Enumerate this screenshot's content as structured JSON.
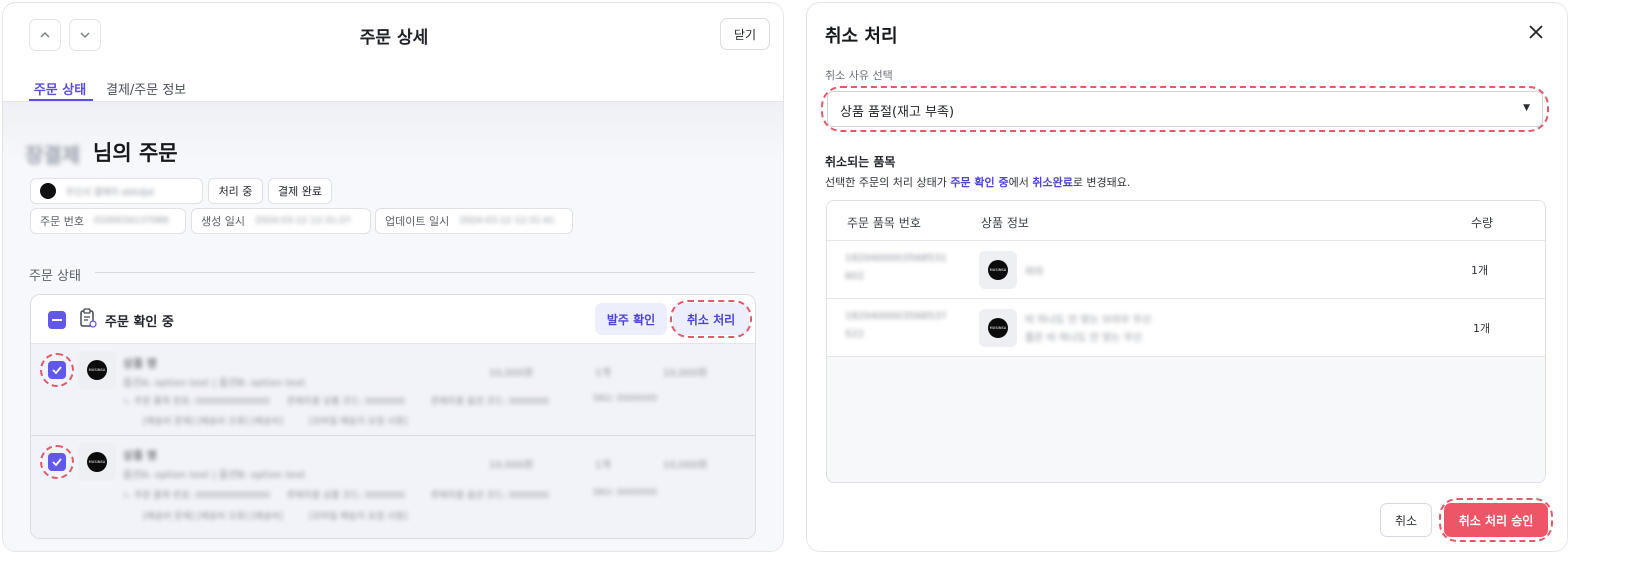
{
  "left": {
    "header": {
      "title": "주문 상세",
      "close_label": "닫기",
      "up_icon": "chevron-up-icon",
      "down_icon": "chevron-down-icon"
    },
    "tabs": [
      {
        "label": "주문 상태",
        "active": true
      },
      {
        "label": "결제/주문 정보",
        "active": false
      }
    ],
    "order_owner": {
      "name_blurred": "장결제",
      "title_suffix": "님의 주문"
    },
    "chips": {
      "buyer_blurred": "무신사 결제자 abkdjal",
      "status_processing": "처리 중",
      "status_paid": "결제 완료",
      "order_no_label": "주문 번호",
      "order_no_value": "0100034137088",
      "created_label": "생성 일시",
      "created_value": "2024-03-12 12:31:27",
      "updated_label": "업데이트 일시",
      "updated_value": "2024-03-12 12:31:41"
    },
    "section_title": "주문 상태",
    "status_group": {
      "label": "주문 확인 중",
      "confirm_label": "발주 확인",
      "cancel_label": "취소 처리"
    },
    "items": [
      {
        "name": "상품 명",
        "option": "옵션A: option text | 옵션B: option text",
        "price": "10,000원",
        "qty": "1개",
        "total": "10,000원",
        "meta1": "ㄴ 주문 품목 번호: 0000000000000",
        "meta2": "판매자용 상품 코드: 0000000",
        "meta3": "판매자용 옵션 코드: 0000000",
        "meta4": "SKU: 0000000",
        "meta5": "[배송비 문제] [배송비 오류] [배송비]",
        "meta6": "[모바일 배송지 요청 사항]"
      },
      {
        "name": "상품 명",
        "option": "옵션A: option text | 옵션B: option text",
        "price": "10,000원",
        "qty": "1개",
        "total": "10,000원",
        "meta1": "ㄴ 주문 품목 번호: 0000000000000",
        "meta2": "판매자용 상품 코드: 0000000",
        "meta3": "판매자용 옵션 코드: 0000000",
        "meta4": "SKU: 0000000",
        "meta5": "[배송비 문제] [배송비 오류] [배송비]",
        "meta6": "[모바일 배송지 요청 사항]"
      }
    ],
    "logo_text": "MUSINSA"
  },
  "right": {
    "title": "취소 처리",
    "reason_label": "취소 사유 선택",
    "reason_value": "상품 품절(재고 부족)",
    "items_title": "취소되는 품목",
    "desc_prefix": "선택한 주문의 처리 상태가 ",
    "desc_from": "주문 확인 중",
    "desc_middle": "에서 ",
    "desc_to": "취소완료",
    "desc_suffix": "로 변경돼요.",
    "table": {
      "headers": [
        "주문 품목 번호",
        "상품 정보",
        "수량"
      ],
      "rows": [
        {
          "no_line1": "1820400003568531",
          "no_line2": "602",
          "info_line1": "피아",
          "info_line2": "",
          "qty": "1개"
        },
        {
          "no_line1": "1820400003568537",
          "no_line2": "522",
          "info_line1": "비 하나도 안 맞는 브라우 무신",
          "info_line2": "품은 비 하나도 안 맞는 무신",
          "qty": "1개"
        }
      ]
    },
    "cancel_label": "취소",
    "approve_label": "취소 처리 승인",
    "accent": "#6158e8",
    "danger": "#ee5566"
  }
}
